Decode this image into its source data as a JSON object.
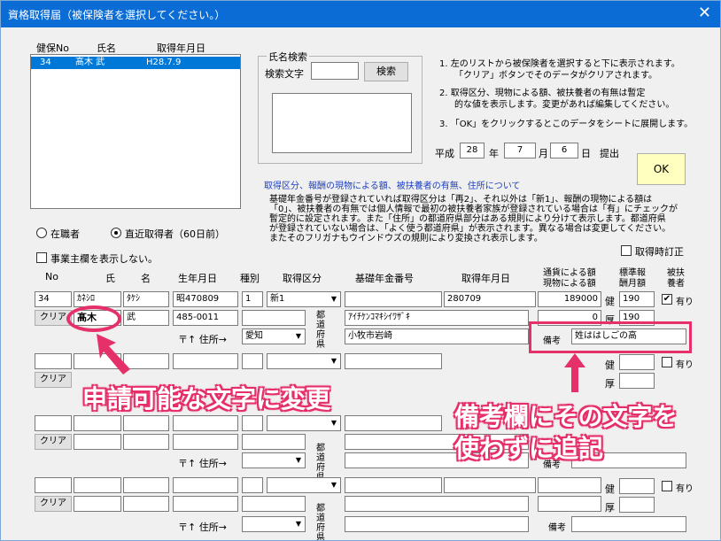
{
  "window": {
    "title": "資格取得届（被保険者を選択してください。）",
    "close": "✕"
  },
  "list": {
    "headers": [
      "健保No",
      "氏名",
      "取得年月日"
    ],
    "rows": [
      {
        "no": "34",
        "name": "髙木 武",
        "date": "H28.7.9"
      }
    ]
  },
  "search": {
    "group_label": "氏名検索",
    "field_label": "検索文字",
    "value": "",
    "button": "検索"
  },
  "instructions": [
    "1. 左のリストから被保険者を選択すると下に表示されます。",
    "「クリア」ボタンでそのデータがクリアされます。",
    "2. 取得区分、現物による額、被扶養者の有無は暫定",
    "的な値を表示します。変更があれば編集してください。",
    "3. 「OK」をクリックするとこのデータをシートに展開します。"
  ],
  "date": {
    "era": "平成",
    "year": "28",
    "year_unit": "年",
    "month": "7",
    "month_unit": "月",
    "day": "6",
    "day_unit": "日",
    "suffix": "提出"
  },
  "ok_button": "OK",
  "note": {
    "heading": "取得区分、報酬の現物による額、被扶養者の有無、住所について",
    "lines": [
      "基礎年金番号が登録されていれば取得区分は「再2」、それ以外は「新1」、報酬の現物による額は",
      "「0」、被扶養者の有無では個人情報で最初の被扶養者家族が登録されている場合は「有」にチェックが",
      "暫定的に設定されます。また「住所」の都道府県部分はある規則により分けて表示します。都道府県",
      "が登録されていない場合は、「よく使う都道府県」が表示されます。異なる場合は変更してください。",
      "またそのフリガナもウインドウズの規則により変換され表示します。"
    ]
  },
  "radios": [
    {
      "label": "在職者",
      "checked": false
    },
    {
      "label": "直近取得者（60日前）",
      "checked": true
    }
  ],
  "hide_owner": "事業主欄を表示しない。",
  "correction": "取得時訂正",
  "grid": {
    "headers": {
      "no": "No",
      "family": "氏",
      "given": "名",
      "birth": "生年月日",
      "kind": "種別",
      "category": "取得区分",
      "pension": "基礎年金番号",
      "acq_date": "取得年月日",
      "amount_1": "通貨による額",
      "amount_2": "現物による額",
      "std_1": "標準報",
      "std_2": "酬月額",
      "dep_1": "被扶",
      "dep_2": "養者"
    },
    "row1": {
      "no": "34",
      "kana_family": "ｶﾈｼﾛ",
      "kana_given": "ﾀｹｼ",
      "birth": "昭470809",
      "kind": "1",
      "category": "新1",
      "acq_date": "280709",
      "amount_cash": "189000",
      "ken": "健",
      "ken_value": "190",
      "dep_check": "✔",
      "dep_label": "有り",
      "clear": "クリア",
      "family": "髙木",
      "given": "武",
      "zip": "485-0011",
      "addr_kana": "ｱｲﾁｹﾝｺﾏｷｼｲﾜｻﾞｷ",
      "amount_goods": "0",
      "kou": "厚",
      "kou_value": "190",
      "pref_label": "都道府県",
      "zip_label": "〒↑ 住所→",
      "pref": "愛知",
      "addr": "小牧市岩崎",
      "remark_label": "備考",
      "remark": "姓ははしごの高"
    },
    "empty": {
      "clear": "クリア",
      "ken": "健",
      "kou": "厚",
      "dep_label": "有り",
      "zip_label": "〒↑ 住所→",
      "pref_label": "都道府県",
      "remark_label": "備考"
    }
  },
  "callouts": {
    "left": "申請可能な文字に変更",
    "right_1": "備考欄にその文字を",
    "right_2": "使わずに追記"
  },
  "colors": {
    "accent": "#e6306a",
    "title_bar": "#0a6cd4",
    "ok_button": "#ffffc0",
    "selection": "#0078d7",
    "link_blue": "#1f3fbf"
  }
}
